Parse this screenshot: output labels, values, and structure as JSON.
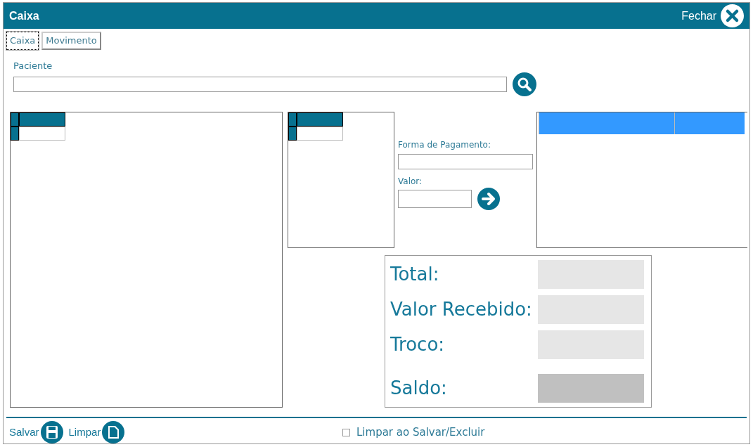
{
  "window": {
    "title": "Caixa",
    "close_label": "Fechar"
  },
  "tabs": [
    {
      "label": "Caixa",
      "selected": true
    },
    {
      "label": "Movimento",
      "selected": false
    }
  ],
  "patient": {
    "label": "Paciente"
  },
  "payment": {
    "method_label": "Forma de Pagamento:",
    "value_label": "Valor:"
  },
  "totals": [
    {
      "label": "Total:",
      "kind": "amount"
    },
    {
      "label": "Valor Recebido:",
      "kind": "amount"
    },
    {
      "label": "Troco:",
      "kind": "amount"
    },
    {
      "label": "Saldo:",
      "kind": "balance"
    }
  ],
  "footer": {
    "buttons": [
      {
        "label": "Salvar",
        "kind": "save"
      },
      {
        "label": "Limpar",
        "kind": "clear"
      }
    ],
    "option": {
      "label": "Limpar ao Salvar/Excluir",
      "checked": false
    }
  }
}
